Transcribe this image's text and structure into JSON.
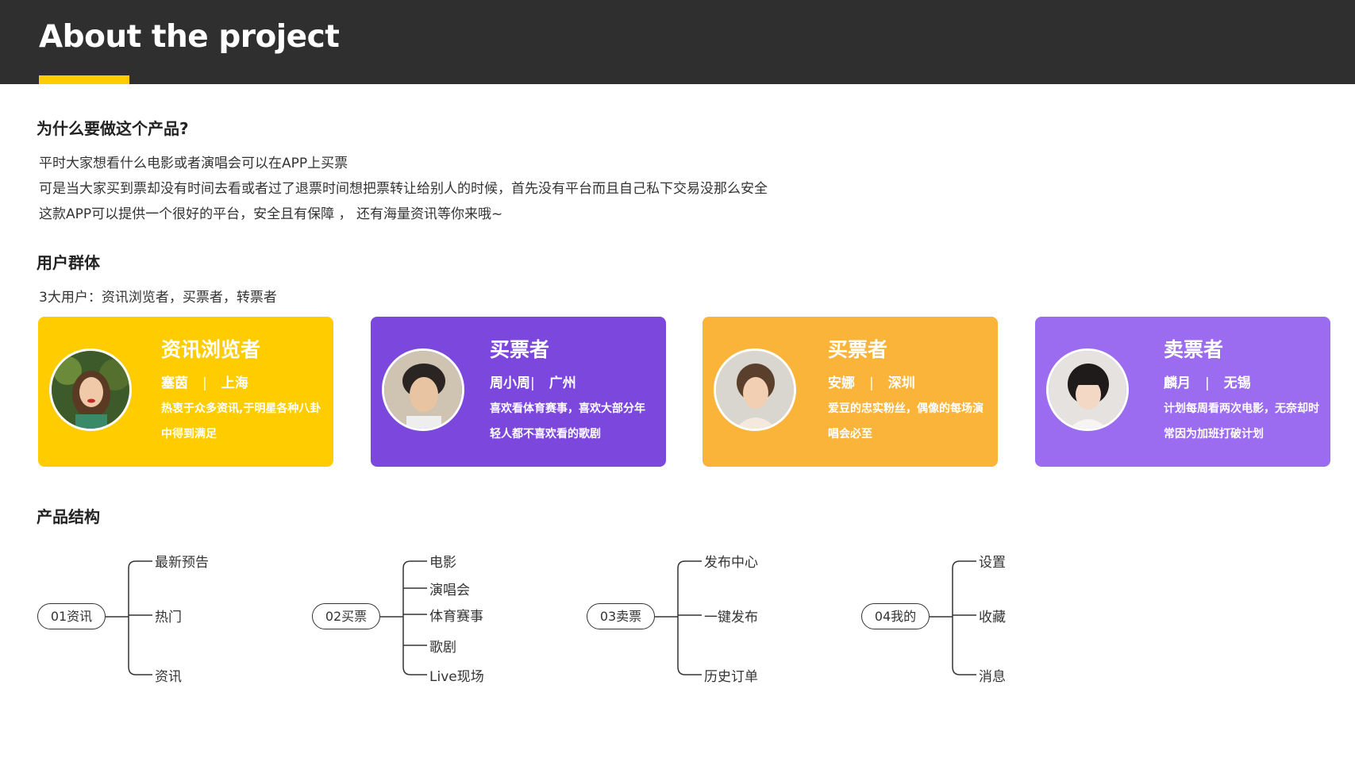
{
  "header": {
    "title": "About the project"
  },
  "why": {
    "heading": "为什么要做这个产品?",
    "lines": [
      "平时大家想看什么电影或者演唱会可以在APP上买票",
      "可是当大家买到票却没有时间去看或者过了退票时间想把票转让给别人的时候，首先没有平台而且自己私下交易没那么安全",
      "这款APP可以提供一个很好的平台，安全且有保障 ， 还有海量资讯等你来哦~"
    ]
  },
  "users": {
    "heading": "用户群体",
    "summary": "3大用户：资讯浏览者，买票者，转票者",
    "cards": [
      {
        "role": "资讯浏览者",
        "name": "塞茵",
        "city": "上海",
        "desc": "热衷于众多资讯,于明星各种八卦中得到满足",
        "color": "#ffcc00"
      },
      {
        "role": "买票者",
        "name": "周小周",
        "city": "广州",
        "desc": "喜欢看体育赛事，喜欢大部分年轻人都不喜欢看的歌剧",
        "color": "#7b47dd"
      },
      {
        "role": "买票者",
        "name": "安娜",
        "city": "深圳",
        "desc": "爱豆的忠实粉丝，偶像的每场演唱会必至",
        "color": "#fbb43a"
      },
      {
        "role": "卖票者",
        "name": "麟月",
        "city": "无锡",
        "desc": "计划每周看两次电影，无奈却时常因为加班打破计划",
        "color": "#9b6cf0"
      }
    ]
  },
  "structure": {
    "heading": "产品结构",
    "trees": [
      {
        "root": "01资讯",
        "leaves": [
          "最新预告",
          "热门",
          "资讯"
        ]
      },
      {
        "root": "02买票",
        "leaves": [
          "电影",
          "演唱会",
          "体育赛事",
          "歌剧",
          "Live现场"
        ]
      },
      {
        "root": "03卖票",
        "leaves": [
          "发布中心",
          "一键发布",
          "历史订单"
        ]
      },
      {
        "root": "04我的",
        "leaves": [
          "设置",
          "收藏",
          "消息"
        ]
      }
    ]
  }
}
